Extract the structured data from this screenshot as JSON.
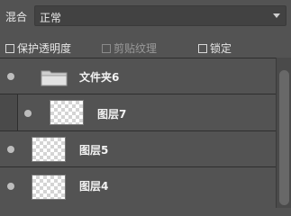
{
  "blend": {
    "label": "混合",
    "value": "正常"
  },
  "locks": [
    {
      "label": "保护透明度",
      "checked": false,
      "enabled": true
    },
    {
      "label": "剪贴纹理",
      "checked": false,
      "enabled": false
    },
    {
      "label": "锁定",
      "checked": false,
      "enabled": true
    }
  ],
  "layers": [
    {
      "name": "文件夹6",
      "type": "folder",
      "visible": true
    },
    {
      "name": "图层7",
      "type": "layer",
      "visible": true,
      "child": true
    },
    {
      "name": "图层5",
      "type": "layer",
      "visible": true
    },
    {
      "name": "图层4",
      "type": "layer",
      "visible": true
    }
  ]
}
